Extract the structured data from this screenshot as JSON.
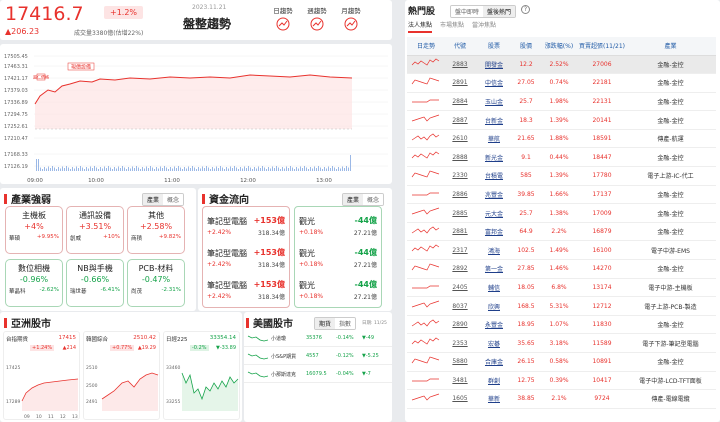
{
  "header": {
    "index": "17416.7",
    "change_pct": "+1.2%",
    "change_pts": "▲206.23",
    "volume": "成交量3380億(估增22%)",
    "date": "2023.11.21",
    "title": "盤整趨勢",
    "buttons": [
      "日趨勢",
      "週趨勢",
      "月趨勢"
    ]
  },
  "intraday": {
    "yticks": [
      "17505.45",
      "17463.31",
      "17421.17",
      "17379.03",
      "17336.89",
      "17294.75",
      "17252.61",
      "17210.47",
      "17168.33",
      "17126.19"
    ],
    "xticks": [
      "09:00",
      "10:00",
      "11:00",
      "12:00",
      "13:00"
    ],
    "labels": [
      "超仁價格",
      "現價設備"
    ]
  },
  "sector": {
    "title": "產業強弱",
    "toggle": [
      "產業",
      "概念"
    ],
    "cards": [
      {
        "name": "主機板",
        "pct": "+4%",
        "l": "華碩",
        "lp": "+9.95%",
        "up": true
      },
      {
        "name": "通訊設備",
        "pct": "+3.51%",
        "l": "創威",
        "lp": "+10%",
        "up": true
      },
      {
        "name": "其他",
        "pct": "+2.58%",
        "l": "商積",
        "lp": "+9.82%",
        "up": true
      },
      {
        "name": "數位相機",
        "pct": "-0.96%",
        "l": "華晶科",
        "lp": "-2.62%",
        "up": false
      },
      {
        "name": "NB與手機",
        "pct": "-0.66%",
        "l": "瑞世碁",
        "lp": "-6.41%",
        "up": false
      },
      {
        "name": "PCB-材料",
        "pct": "-0.47%",
        "l": "尚茂",
        "lp": "-2.31%",
        "up": false
      }
    ]
  },
  "flow": {
    "title": "資金流向",
    "toggle": [
      "產業",
      "概念"
    ],
    "up": {
      "name": "筆記型電腦",
      "val": "+153億",
      "pct": "+2.42%",
      "amt": "318.34億"
    },
    "down": {
      "name": "觀光",
      "val": "-44億",
      "pct": "+0.18%",
      "amt": "27.21億"
    }
  },
  "asia": {
    "title": "亞洲股市",
    "items": [
      {
        "name": "台指期貨",
        "val": "17415",
        "pct": "+1.24%",
        "chg": "▲214",
        "yt": [
          "17425",
          "17289"
        ],
        "xt": [
          "09",
          "10",
          "11",
          "12",
          "13"
        ]
      },
      {
        "name": "韓國綜合",
        "val": "2510.42",
        "pct": "+0.77%",
        "chg": "▲19.29",
        "yt": [
          "2510",
          "2500",
          "2491"
        ],
        "xt": []
      },
      {
        "name": "日經225",
        "val": "33354.14",
        "pct": "-0.2%",
        "chg": "▼-33.89",
        "yt": [
          "33460",
          "33255"
        ],
        "xt": []
      }
    ]
  },
  "us": {
    "title": "美國股市",
    "toggle": [
      "期貨",
      "指數"
    ],
    "date": "日期: 11/25",
    "rows": [
      {
        "name": "小道瓊",
        "val": "35376",
        "pct": "-0.14%",
        "chg": "▼-49"
      },
      {
        "name": "小S&P期貨",
        "val": "4557",
        "pct": "-0.12%",
        "chg": "▼-5.25"
      },
      {
        "name": "小那斯達克",
        "val": "16079.5",
        "pct": "-0.04%",
        "chg": "▼-7"
      }
    ]
  },
  "hot": {
    "title": "熱門股",
    "help": "?",
    "top_tabs": [
      "盤中即時",
      "盤後熱門"
    ],
    "sub_tabs": [
      "法人焦點",
      "市場焦點",
      "當沖焦點"
    ],
    "headers": [
      "日走勢",
      "代號",
      "股票",
      "股價",
      "漲跌幅(%)",
      "買賣超張(11/21)",
      "產業"
    ],
    "rows": [
      [
        "2883",
        "開發金",
        "12.2",
        "2.52%",
        "27006",
        "金融-金控"
      ],
      [
        "2891",
        "中信金",
        "27.05",
        "0.74%",
        "22181",
        "金融-金控"
      ],
      [
        "2884",
        "玉山金",
        "25.7",
        "1.98%",
        "22131",
        "金融-金控"
      ],
      [
        "2887",
        "台新金",
        "18.3",
        "1.39%",
        "20141",
        "金融-金控"
      ],
      [
        "2610",
        "華航",
        "21.65",
        "1.88%",
        "18591",
        "傳產-航運"
      ],
      [
        "2888",
        "新光金",
        "9.1",
        "0.44%",
        "18447",
        "金融-金控"
      ],
      [
        "2330",
        "台積電",
        "585",
        "1.39%",
        "17780",
        "電子上游-IC-代工"
      ],
      [
        "2886",
        "兆豐金",
        "39.85",
        "1.66%",
        "17137",
        "金融-金控"
      ],
      [
        "2885",
        "元大金",
        "25.7",
        "1.38%",
        "17009",
        "金融-金控"
      ],
      [
        "2881",
        "富邦金",
        "64.9",
        "2.2%",
        "16879",
        "金融-金控"
      ],
      [
        "2317",
        "鴻海",
        "102.5",
        "1.49%",
        "16100",
        "電子中游-EMS"
      ],
      [
        "2892",
        "第一金",
        "27.85",
        "1.46%",
        "14270",
        "金融-金控"
      ],
      [
        "2405",
        "輔信",
        "18.05",
        "6.8%",
        "13174",
        "電子中游-主機板"
      ],
      [
        "8037",
        "欣興",
        "168.5",
        "5.31%",
        "12712",
        "電子上游-PCB-製造"
      ],
      [
        "2890",
        "永豐金",
        "18.95",
        "1.07%",
        "11830",
        "金融-金控"
      ],
      [
        "2353",
        "宏碁",
        "35.65",
        "3.18%",
        "11589",
        "電子下游-筆記型電腦"
      ],
      [
        "5880",
        "合庫金",
        "26.15",
        "0.58%",
        "10891",
        "金融-金控"
      ],
      [
        "3481",
        "群創",
        "12.75",
        "0.39%",
        "10417",
        "電子中游-LCD-TFT面板"
      ],
      [
        "1605",
        "華新",
        "38.85",
        "2.1%",
        "9724",
        "傳產-電線電纜"
      ]
    ]
  }
}
